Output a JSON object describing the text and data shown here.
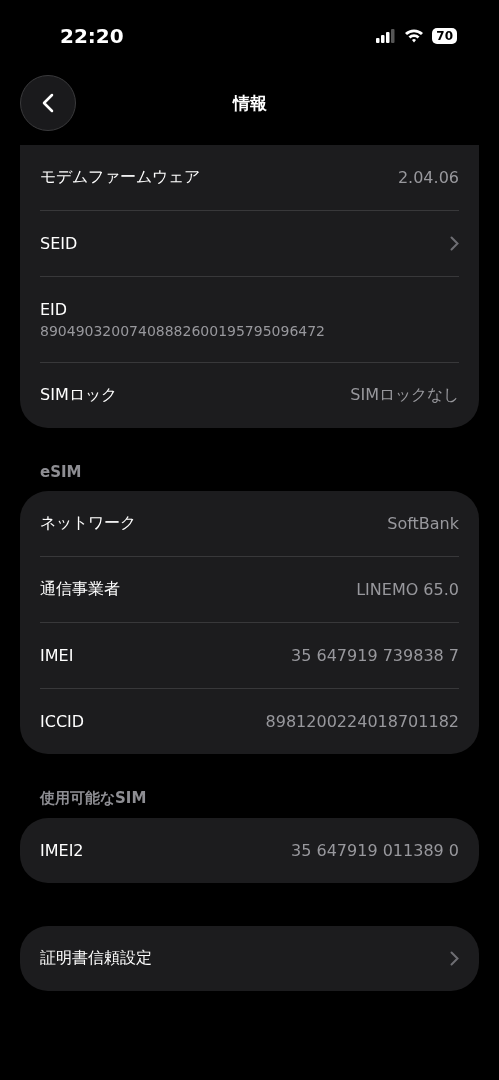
{
  "status_bar": {
    "time": "22:20",
    "battery": "70"
  },
  "header": {
    "title": "情報"
  },
  "sections": [
    {
      "rows": [
        {
          "kind": "value",
          "label": "モデムファームウェア",
          "value": "2.04.06"
        },
        {
          "kind": "chevron",
          "label": "SEID"
        },
        {
          "kind": "stacked",
          "label": "EID",
          "value": "89049032007408882600195795096472"
        },
        {
          "kind": "value",
          "label": "SIMロック",
          "value": "SIMロックなし"
        }
      ]
    },
    {
      "title": "eSIM",
      "rows": [
        {
          "kind": "value",
          "label": "ネットワーク",
          "value": "SoftBank"
        },
        {
          "kind": "value",
          "label": "通信事業者",
          "value": "LINEMO 65.0"
        },
        {
          "kind": "value",
          "label": "IMEI",
          "value": "35 647919 739838 7"
        },
        {
          "kind": "value",
          "label": "ICCID",
          "value": "8981200224018701182"
        }
      ]
    },
    {
      "title": "使用可能なSIM",
      "rows": [
        {
          "kind": "value",
          "label": "IMEI2",
          "value": "35 647919 011389 0"
        }
      ]
    },
    {
      "rows": [
        {
          "kind": "chevron",
          "label": "証明書信頼設定"
        }
      ]
    }
  ]
}
